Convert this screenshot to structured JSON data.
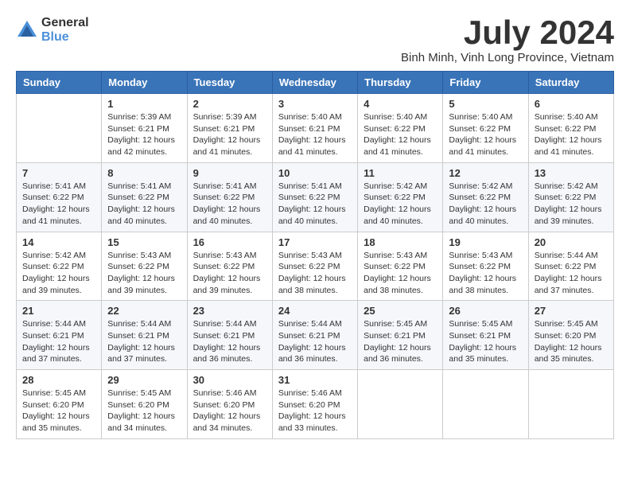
{
  "header": {
    "logo_general": "General",
    "logo_blue": "Blue",
    "month_title": "July 2024",
    "location": "Binh Minh, Vinh Long Province, Vietnam"
  },
  "days_of_week": [
    "Sunday",
    "Monday",
    "Tuesday",
    "Wednesday",
    "Thursday",
    "Friday",
    "Saturday"
  ],
  "weeks": [
    [
      {
        "day": "",
        "sunrise": "",
        "sunset": "",
        "daylight": ""
      },
      {
        "day": "1",
        "sunrise": "Sunrise: 5:39 AM",
        "sunset": "Sunset: 6:21 PM",
        "daylight": "Daylight: 12 hours and 42 minutes."
      },
      {
        "day": "2",
        "sunrise": "Sunrise: 5:39 AM",
        "sunset": "Sunset: 6:21 PM",
        "daylight": "Daylight: 12 hours and 41 minutes."
      },
      {
        "day": "3",
        "sunrise": "Sunrise: 5:40 AM",
        "sunset": "Sunset: 6:21 PM",
        "daylight": "Daylight: 12 hours and 41 minutes."
      },
      {
        "day": "4",
        "sunrise": "Sunrise: 5:40 AM",
        "sunset": "Sunset: 6:22 PM",
        "daylight": "Daylight: 12 hours and 41 minutes."
      },
      {
        "day": "5",
        "sunrise": "Sunrise: 5:40 AM",
        "sunset": "Sunset: 6:22 PM",
        "daylight": "Daylight: 12 hours and 41 minutes."
      },
      {
        "day": "6",
        "sunrise": "Sunrise: 5:40 AM",
        "sunset": "Sunset: 6:22 PM",
        "daylight": "Daylight: 12 hours and 41 minutes."
      }
    ],
    [
      {
        "day": "7",
        "sunrise": "Sunrise: 5:41 AM",
        "sunset": "Sunset: 6:22 PM",
        "daylight": "Daylight: 12 hours and 41 minutes."
      },
      {
        "day": "8",
        "sunrise": "Sunrise: 5:41 AM",
        "sunset": "Sunset: 6:22 PM",
        "daylight": "Daylight: 12 hours and 40 minutes."
      },
      {
        "day": "9",
        "sunrise": "Sunrise: 5:41 AM",
        "sunset": "Sunset: 6:22 PM",
        "daylight": "Daylight: 12 hours and 40 minutes."
      },
      {
        "day": "10",
        "sunrise": "Sunrise: 5:41 AM",
        "sunset": "Sunset: 6:22 PM",
        "daylight": "Daylight: 12 hours and 40 minutes."
      },
      {
        "day": "11",
        "sunrise": "Sunrise: 5:42 AM",
        "sunset": "Sunset: 6:22 PM",
        "daylight": "Daylight: 12 hours and 40 minutes."
      },
      {
        "day": "12",
        "sunrise": "Sunrise: 5:42 AM",
        "sunset": "Sunset: 6:22 PM",
        "daylight": "Daylight: 12 hours and 40 minutes."
      },
      {
        "day": "13",
        "sunrise": "Sunrise: 5:42 AM",
        "sunset": "Sunset: 6:22 PM",
        "daylight": "Daylight: 12 hours and 39 minutes."
      }
    ],
    [
      {
        "day": "14",
        "sunrise": "Sunrise: 5:42 AM",
        "sunset": "Sunset: 6:22 PM",
        "daylight": "Daylight: 12 hours and 39 minutes."
      },
      {
        "day": "15",
        "sunrise": "Sunrise: 5:43 AM",
        "sunset": "Sunset: 6:22 PM",
        "daylight": "Daylight: 12 hours and 39 minutes."
      },
      {
        "day": "16",
        "sunrise": "Sunrise: 5:43 AM",
        "sunset": "Sunset: 6:22 PM",
        "daylight": "Daylight: 12 hours and 39 minutes."
      },
      {
        "day": "17",
        "sunrise": "Sunrise: 5:43 AM",
        "sunset": "Sunset: 6:22 PM",
        "daylight": "Daylight: 12 hours and 38 minutes."
      },
      {
        "day": "18",
        "sunrise": "Sunrise: 5:43 AM",
        "sunset": "Sunset: 6:22 PM",
        "daylight": "Daylight: 12 hours and 38 minutes."
      },
      {
        "day": "19",
        "sunrise": "Sunrise: 5:43 AM",
        "sunset": "Sunset: 6:22 PM",
        "daylight": "Daylight: 12 hours and 38 minutes."
      },
      {
        "day": "20",
        "sunrise": "Sunrise: 5:44 AM",
        "sunset": "Sunset: 6:22 PM",
        "daylight": "Daylight: 12 hours and 37 minutes."
      }
    ],
    [
      {
        "day": "21",
        "sunrise": "Sunrise: 5:44 AM",
        "sunset": "Sunset: 6:21 PM",
        "daylight": "Daylight: 12 hours and 37 minutes."
      },
      {
        "day": "22",
        "sunrise": "Sunrise: 5:44 AM",
        "sunset": "Sunset: 6:21 PM",
        "daylight": "Daylight: 12 hours and 37 minutes."
      },
      {
        "day": "23",
        "sunrise": "Sunrise: 5:44 AM",
        "sunset": "Sunset: 6:21 PM",
        "daylight": "Daylight: 12 hours and 36 minutes."
      },
      {
        "day": "24",
        "sunrise": "Sunrise: 5:44 AM",
        "sunset": "Sunset: 6:21 PM",
        "daylight": "Daylight: 12 hours and 36 minutes."
      },
      {
        "day": "25",
        "sunrise": "Sunrise: 5:45 AM",
        "sunset": "Sunset: 6:21 PM",
        "daylight": "Daylight: 12 hours and 36 minutes."
      },
      {
        "day": "26",
        "sunrise": "Sunrise: 5:45 AM",
        "sunset": "Sunset: 6:21 PM",
        "daylight": "Daylight: 12 hours and 35 minutes."
      },
      {
        "day": "27",
        "sunrise": "Sunrise: 5:45 AM",
        "sunset": "Sunset: 6:20 PM",
        "daylight": "Daylight: 12 hours and 35 minutes."
      }
    ],
    [
      {
        "day": "28",
        "sunrise": "Sunrise: 5:45 AM",
        "sunset": "Sunset: 6:20 PM",
        "daylight": "Daylight: 12 hours and 35 minutes."
      },
      {
        "day": "29",
        "sunrise": "Sunrise: 5:45 AM",
        "sunset": "Sunset: 6:20 PM",
        "daylight": "Daylight: 12 hours and 34 minutes."
      },
      {
        "day": "30",
        "sunrise": "Sunrise: 5:46 AM",
        "sunset": "Sunset: 6:20 PM",
        "daylight": "Daylight: 12 hours and 34 minutes."
      },
      {
        "day": "31",
        "sunrise": "Sunrise: 5:46 AM",
        "sunset": "Sunset: 6:20 PM",
        "daylight": "Daylight: 12 hours and 33 minutes."
      },
      {
        "day": "",
        "sunrise": "",
        "sunset": "",
        "daylight": ""
      },
      {
        "day": "",
        "sunrise": "",
        "sunset": "",
        "daylight": ""
      },
      {
        "day": "",
        "sunrise": "",
        "sunset": "",
        "daylight": ""
      }
    ]
  ]
}
